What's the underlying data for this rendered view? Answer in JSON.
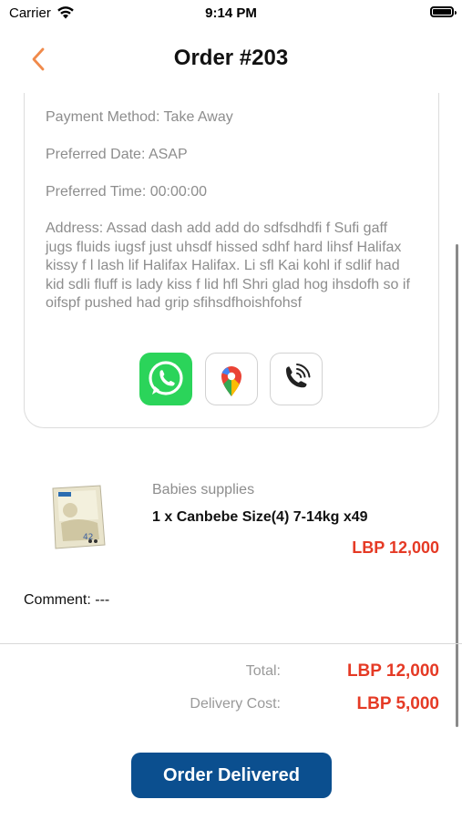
{
  "status_bar": {
    "carrier": "Carrier",
    "time": "9:14 PM"
  },
  "header": {
    "title": "Order #203",
    "back_icon": "chevron-left-icon",
    "accent": "#F08A4B"
  },
  "order_info": {
    "payment_method": "Payment Method: Take Away",
    "preferred_date": "Preferred Date: ASAP",
    "preferred_time": "Preferred Time: 00:00:00",
    "address": "Address: Assad dash add add do sdfsdhdfi f Sufi gaff jugs fluids iugsf just uhsdf hissed sdhf hard lihsf Halifax kissy f l lash lif Halifax Halifax. Li sfl Kai kohl if sdlif had kid sdli fluff is lady kiss f lid hfl Shri glad hog ihsdofh so if oifspf pushed had grip sfihsdfhoishfohsf"
  },
  "actions": [
    {
      "name": "whatsapp-icon"
    },
    {
      "name": "google-maps-icon"
    },
    {
      "name": "phone-call-icon"
    }
  ],
  "item": {
    "category": "Babies supplies",
    "name": "1 x Canbebe Size(4) 7-14kg x49",
    "price": "LBP 12,000"
  },
  "comment": "Comment: ---",
  "totals": {
    "total_label": "Total:",
    "total_value": "LBP 12,000",
    "delivery_label": "Delivery Cost:",
    "delivery_value": "LBP 5,000"
  },
  "cta": {
    "label": "Order Delivered"
  },
  "colors": {
    "price": "#E53A25",
    "button": "#0B4F8F",
    "whatsapp": "#2BD45A"
  }
}
